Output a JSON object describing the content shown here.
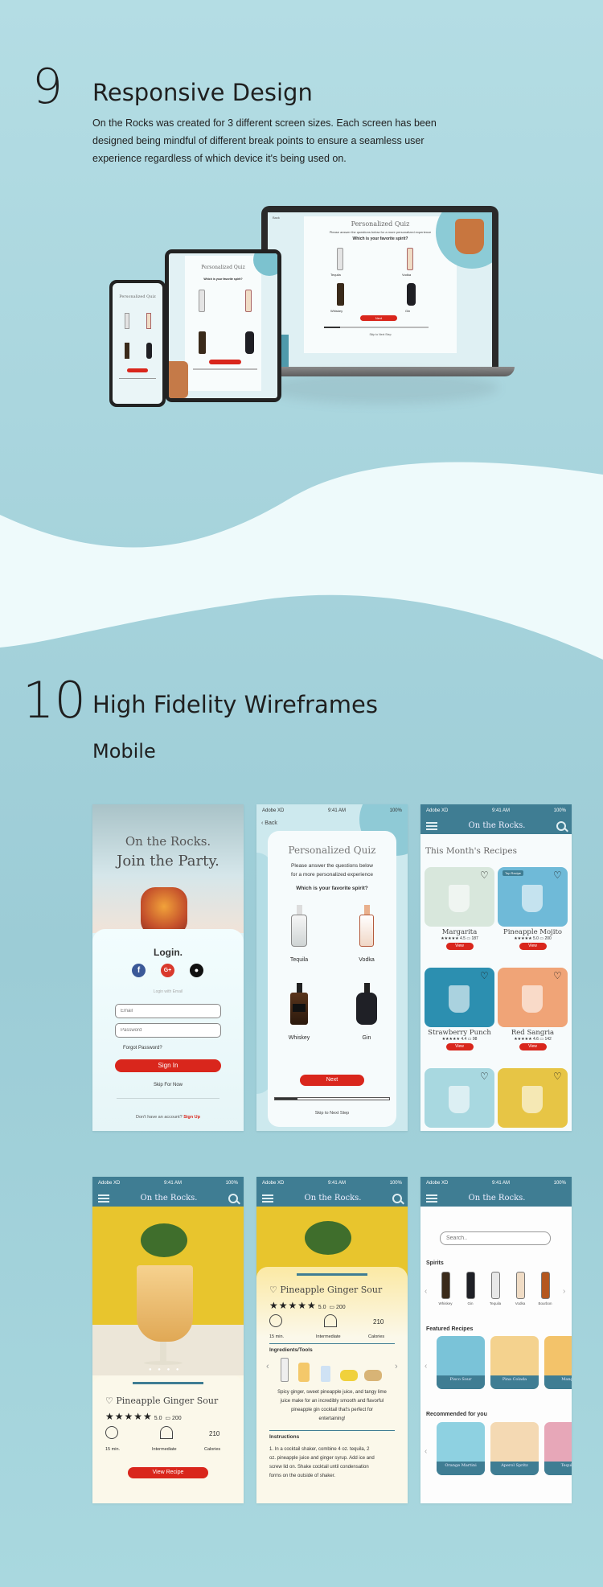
{
  "section9": {
    "number": "9",
    "title": "Responsive Design",
    "paragraph": [
      "On the Rocks was created for 3 different screen sizes. Each screen has been",
      "designed being mindful of different break points to ensure a seamless user",
      "experience regardless of which device it's being used on."
    ]
  },
  "devices": {
    "quiz_title": "Personalized Quiz",
    "quiz_intro": "Please answer the questions below for a more personalized experience",
    "quiz_question": "Which is your favorite spirit?",
    "options": [
      "Tequila",
      "Vodka",
      "Whiskey",
      "Gin"
    ],
    "next": "Next",
    "skip": "Skip to Next Step",
    "back": "Back"
  },
  "section10": {
    "number": "10",
    "title": "High Fidelity Wireframes",
    "subtitle": "Mobile"
  },
  "status": {
    "carrier": "Adobe XD",
    "time": "9:41 AM",
    "battery": "100%"
  },
  "brand": "On the Rocks.",
  "login": {
    "hero_line1": "On the Rocks.",
    "hero_line2": "Join the Party.",
    "heading": "Login.",
    "social_icons": [
      "facebook-icon",
      "google-icon",
      "apple-icon"
    ],
    "divider_text": "Login with Email",
    "email_placeholder": "Email",
    "password_placeholder": "Password",
    "forgot": "Forgot Password?",
    "sign_in": "Sign In",
    "skip": "Skip For Now",
    "no_account": "Don't have an account?",
    "sign_up": "Sign Up"
  },
  "quiz": {
    "back": "Back",
    "title": "Personalized Quiz",
    "intro_line1": "Please answer the questions below",
    "intro_line2": "for a more personalized experience",
    "question": "Which is your favorite spirit?",
    "options": [
      "Tequila",
      "Vodka",
      "Whiskey",
      "Gin"
    ],
    "next": "Next",
    "skip": "Skip to Next Step",
    "progress": 0.2
  },
  "recipes": {
    "heading": "This Month's Recipes",
    "badge": "Top Recipe",
    "view": "View",
    "items": [
      {
        "name": "Margarita",
        "rating": "4.5",
        "reviews": "187",
        "color": "#d8e7dc"
      },
      {
        "name": "Pineapple Mojito",
        "rating": "5.0",
        "reviews": "200",
        "color": "#6fbad8"
      },
      {
        "name": "Strawberry Punch",
        "rating": "4.4",
        "reviews": "98",
        "color": "#2c8fb0"
      },
      {
        "name": "Red Sangria",
        "rating": "4.6",
        "reviews": "142",
        "color": "#f0a477"
      },
      {
        "name": "",
        "rating": "",
        "reviews": "",
        "color": "#a8d8e0"
      },
      {
        "name": "",
        "rating": "",
        "reviews": "",
        "color": "#e7c545"
      }
    ]
  },
  "detail": {
    "name": "Pineapple Ginger Sour",
    "rating": "5.0",
    "comments": "200",
    "time": "15 min.",
    "level": "Intermediate",
    "calories_value": "210",
    "calories": "Calories",
    "cta": "View Recipe",
    "ingredients_heading": "Ingredients/Tools",
    "description": [
      "Spicy ginger, sweet pineapple juice, and tangy lime",
      "juice make for an incredibly smooth and flavorful",
      "pineapple gin cocktail that's perfect for",
      "entertaining!"
    ],
    "instructions_heading": "Instructions",
    "instructions": [
      "1. In a cocktail shaker, combine 4 oz. tequila, 2",
      "oz. pineapple juice and ginger syrup. Add ice and",
      "screw lid on. Shake cocktail until condensation",
      "forms on the outside of shaker."
    ]
  },
  "browse": {
    "search_placeholder": "Search..",
    "spirits_heading": "Spirits",
    "spirits": [
      "Whiskey",
      "Gin",
      "Tequila",
      "Vodka",
      "Bourbon"
    ],
    "featured_heading": "Featured Recipes",
    "featured": [
      "Pisco Sour",
      "Pina Colada",
      "Mango"
    ],
    "recommended_heading": "Recommended for you",
    "recommended": [
      "Orange Martini",
      "Aperol Spritz",
      "Tequila"
    ]
  },
  "colors": {
    "teal_nav": "#3f7d93",
    "accent_red": "#d9261c",
    "page_bg": "#a9d8df"
  }
}
